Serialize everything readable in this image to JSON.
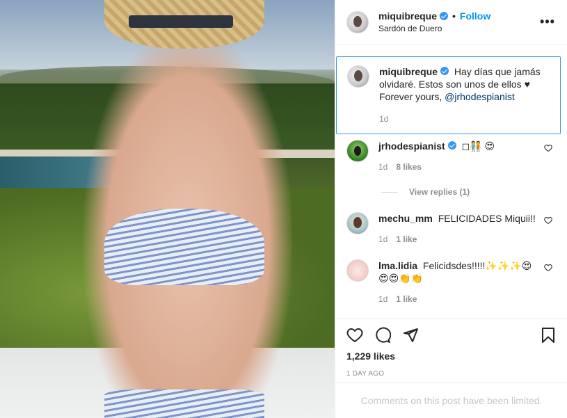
{
  "post": {
    "author": {
      "username": "miquibreque",
      "location": "Sardón de Duero",
      "follow_label": "Follow",
      "verified": true
    },
    "caption": {
      "username": "miquibreque",
      "text": "Hay días que jamás olvidaré. Estos son unos de ellos ♥ Forever yours,",
      "mention": "@jrhodespianist",
      "time": "1d"
    },
    "comments": [
      {
        "username": "jrhodespianist",
        "verified": true,
        "text": "◻🧑‍🤝‍🧑 😍",
        "time": "1d",
        "likes": "8 likes",
        "replies_label": "View replies (1)"
      },
      {
        "username": "mechu_mm",
        "verified": false,
        "text": "FELICIDADES Miquii!!",
        "time": "1d",
        "likes": "1 like"
      },
      {
        "username": "lma.lidia",
        "verified": false,
        "text": "Felicidsdes!!!!!✨✨✨😍 😍😍👏👏",
        "time": "1d",
        "likes": "1 like"
      }
    ],
    "likes_count": "1,229 likes",
    "timestamp": "1 DAY AGO",
    "comments_limited": "Comments on this post have been limited."
  },
  "colors": {
    "accent": "#0095f6",
    "verified": "#3897f0",
    "muted": "#8e8e8e",
    "border": "#efefef"
  },
  "icons": [
    "more-icon",
    "heart-icon",
    "comment-icon",
    "share-icon",
    "bookmark-icon",
    "verified-icon"
  ]
}
